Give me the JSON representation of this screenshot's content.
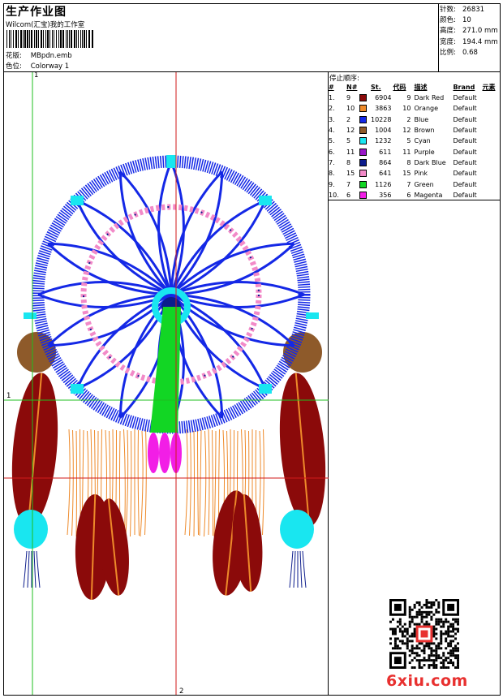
{
  "header": {
    "title": "生产作业图",
    "company": "Wilcom(汇宝)我的工作室",
    "design_label": "花版:",
    "design_value": "MBpdn.emb",
    "colorway_label": "色位:",
    "colorway_value": "Colorway 1"
  },
  "stats": [
    {
      "label": "针数:",
      "value": "26831"
    },
    {
      "label": "颜色:",
      "value": "10"
    },
    {
      "label": "高度:",
      "value": "271.0 mm"
    },
    {
      "label": "宽度:",
      "value": "194.4 mm"
    },
    {
      "label": "比例:",
      "value": "0.68"
    }
  ],
  "stop_sequence": {
    "title": "停止顺序:",
    "headers": [
      "#",
      "N#",
      "St.",
      "代码",
      "描述",
      "Brand",
      "元素"
    ],
    "rows": [
      {
        "idx": "1.",
        "n": "9",
        "color": "#8b0a0a",
        "st": "6904",
        "code": "9",
        "desc": "Dark Red",
        "brand": "Default"
      },
      {
        "idx": "2.",
        "n": "10",
        "color": "#ee8a2a",
        "st": "3863",
        "code": "10",
        "desc": "Orange",
        "brand": "Default"
      },
      {
        "idx": "3.",
        "n": "2",
        "color": "#1428e6",
        "st": "10228",
        "code": "2",
        "desc": "Blue",
        "brand": "Default"
      },
      {
        "idx": "4.",
        "n": "12",
        "color": "#8e5a2a",
        "st": "1004",
        "code": "12",
        "desc": "Brown",
        "brand": "Default"
      },
      {
        "idx": "5.",
        "n": "5",
        "color": "#19e6f0",
        "st": "1232",
        "code": "5",
        "desc": "Cyan",
        "brand": "Default"
      },
      {
        "idx": "6.",
        "n": "11",
        "color": "#9a18c8",
        "st": "611",
        "code": "11",
        "desc": "Purple",
        "brand": "Default"
      },
      {
        "idx": "7.",
        "n": "8",
        "color": "#0c1c8c",
        "st": "864",
        "code": "8",
        "desc": "Dark Blue",
        "brand": "Default"
      },
      {
        "idx": "8.",
        "n": "15",
        "color": "#f28ac8",
        "st": "641",
        "code": "15",
        "desc": "Pink",
        "brand": "Default"
      },
      {
        "idx": "9.",
        "n": "7",
        "color": "#12d624",
        "st": "1126",
        "code": "7",
        "desc": "Green",
        "brand": "Default"
      },
      {
        "idx": "10.",
        "n": "6",
        "color": "#f21ee6",
        "st": "356",
        "code": "6",
        "desc": "Magenta",
        "brand": "Default"
      }
    ]
  },
  "axis_labels": {
    "v": "1",
    "v2": "2",
    "h": "1"
  },
  "footer": {
    "logo": "6xiu.com"
  }
}
